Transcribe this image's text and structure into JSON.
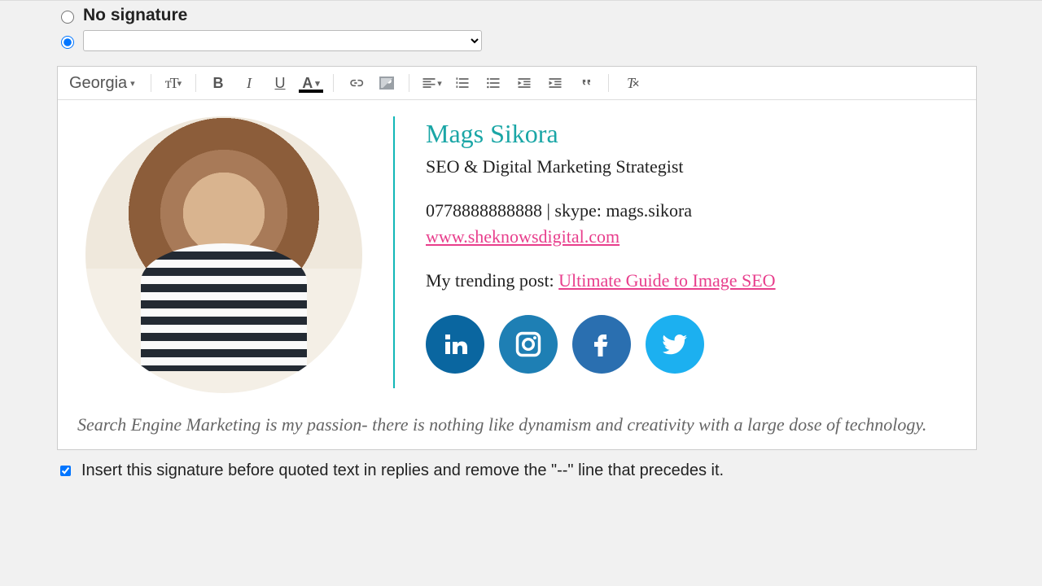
{
  "options": {
    "no_signature_label": "No signature",
    "insert_before_quote_label": "Insert this signature before quoted text in replies and remove the \"--\" line that precedes it."
  },
  "toolbar": {
    "font": "Georgia"
  },
  "signature": {
    "name": "Mags Sikora",
    "title": "SEO & Digital Marketing Strategist",
    "phone": "0778888888888",
    "contact_separator": " | ",
    "skype_label": "skype: ",
    "skype": "mags.sikora",
    "website": "www.sheknowsdigital.com",
    "trending_label": "My trending post: ",
    "trending_link": "Ultimate Guide to Image SEO",
    "tagline": "Search Engine Marketing is my passion- there is nothing like dynamism and creativity with a large dose of technology."
  },
  "socials": {
    "linkedin": "linkedin",
    "instagram": "instagram",
    "facebook": "facebook",
    "twitter": "twitter"
  }
}
